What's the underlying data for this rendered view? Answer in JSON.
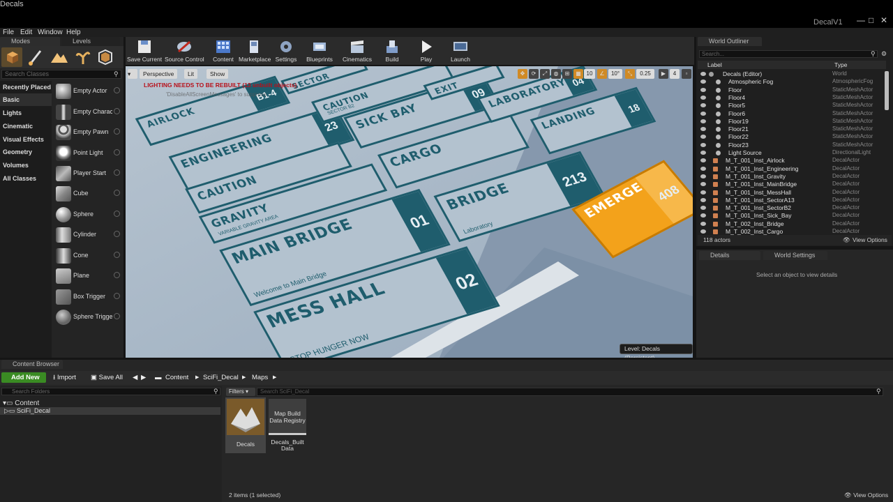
{
  "window": {
    "tab_title": "Decals",
    "project_name": "DecalV1",
    "logo_letter": "U",
    "controls": [
      "—",
      "□",
      "✕"
    ]
  },
  "menu": [
    "File",
    "Edit",
    "Window",
    "Help"
  ],
  "modes_panel": {
    "tab_modes": "Modes",
    "tab_levels": "Levels",
    "search_placeholder": "Search Classes",
    "categories": [
      "Recently Placed",
      "Basic",
      "Lights",
      "Cinematic",
      "Visual Effects",
      "Geometry",
      "Volumes",
      "All Classes"
    ],
    "selected_category": "Basic",
    "items": [
      "Empty Actor",
      "Empty Charact",
      "Empty Pawn",
      "Point Light",
      "Player Start",
      "Cube",
      "Sphere",
      "Cylinder",
      "Cone",
      "Plane",
      "Box Trigger",
      "Sphere Trigge"
    ]
  },
  "toolbar": {
    "buttons": [
      "Save Current",
      "Source Control",
      "Content",
      "Marketplace",
      "Settings",
      "Blueprints",
      "Cinematics",
      "Build",
      "Play",
      "Launch"
    ]
  },
  "viewport": {
    "perspective": "Perspective",
    "lit": "Lit",
    "show": "Show",
    "warning": "LIGHTING NEEDS TO BE REBUILT (13 unbuilt objects)",
    "warning_sub": "'DisableAllScreenMessages' to suppress",
    "level": "Level:  Decals (Persistent)",
    "grid_snap": "10",
    "rot_snap": "10°",
    "scale_snap": "0.25",
    "cam_speed": "4",
    "signs": [
      {
        "title": "AIRLOCK",
        "num": "B1-4"
      },
      {
        "title": "ENGINEERING",
        "num": "23"
      },
      {
        "title": "CAUTION",
        "num": ""
      },
      {
        "title": "GRAVITY",
        "num": "",
        "sub": "VARIABLE GRAVITY AREA"
      },
      {
        "title": "MAIN BRIDGE",
        "num": "01",
        "sub": "Welcome to Main Bridge"
      },
      {
        "title": "MESS HALL",
        "num": "02",
        "sub": "STOP HUNGER NOW"
      },
      {
        "title": "SICK BAY",
        "num": "09"
      },
      {
        "title": "CARGO",
        "num": ""
      },
      {
        "title": "BRIDGE",
        "num": "213",
        "sub": "Laboratory"
      },
      {
        "title": "LABORATORY",
        "num": "04"
      },
      {
        "title": "LANDING",
        "num": "18"
      },
      {
        "title": "CAUTION",
        "num": "",
        "sub": "SECTOR B2"
      },
      {
        "title": "SECTOR",
        "num": ""
      },
      {
        "title": "EXIT",
        "num": ""
      },
      {
        "title": "EMERGENCY",
        "num": "408"
      }
    ]
  },
  "outliner": {
    "tab": "World Outliner",
    "search_placeholder": "Search...",
    "col_label": "Label",
    "col_type": "Type",
    "rows": [
      {
        "label": "Decals (Editor)",
        "type": "World",
        "indent": 0
      },
      {
        "label": "Atmospheric Fog",
        "type": "AtmosphericFog",
        "indent": 1
      },
      {
        "label": "Floor",
        "type": "StaticMeshActor",
        "indent": 1
      },
      {
        "label": "Floor4",
        "type": "StaticMeshActor",
        "indent": 1
      },
      {
        "label": "Floor5",
        "type": "StaticMeshActor",
        "indent": 1
      },
      {
        "label": "Floor6",
        "type": "StaticMeshActor",
        "indent": 1
      },
      {
        "label": "Floor19",
        "type": "StaticMeshActor",
        "indent": 1
      },
      {
        "label": "Floor21",
        "type": "StaticMeshActor",
        "indent": 1
      },
      {
        "label": "Floor22",
        "type": "StaticMeshActor",
        "indent": 1
      },
      {
        "label": "Floor23",
        "type": "StaticMeshActor",
        "indent": 1
      },
      {
        "label": "Light Source",
        "type": "DirectionalLight",
        "indent": 1
      },
      {
        "label": "M_T_001_Inst_Airlock",
        "type": "DecalActor",
        "indent": 0
      },
      {
        "label": "M_T_001_Inst_Engineering",
        "type": "DecalActor",
        "indent": 0
      },
      {
        "label": "M_T_001_Inst_Gravity",
        "type": "DecalActor",
        "indent": 0
      },
      {
        "label": "M_T_001_Inst_MainBridge",
        "type": "DecalActor",
        "indent": 0
      },
      {
        "label": "M_T_001_Inst_MessHall",
        "type": "DecalActor",
        "indent": 0
      },
      {
        "label": "M_T_001_Inst_SectorA13",
        "type": "DecalActor",
        "indent": 0
      },
      {
        "label": "M_T_001_Inst_SectorB2",
        "type": "DecalActor",
        "indent": 0
      },
      {
        "label": "M_T_001_Inst_Sick_Bay",
        "type": "DecalActor",
        "indent": 0
      },
      {
        "label": "M_T_002_Inst_Bridge",
        "type": "DecalActor",
        "indent": 0
      },
      {
        "label": "M_T_002_Inst_Cargo",
        "type": "DecalActor",
        "indent": 0
      }
    ],
    "count": "118 actors",
    "view_options": "View Options"
  },
  "details": {
    "tab": "Details",
    "tab2": "World Settings",
    "message": "Select an object to view details"
  },
  "content_browser": {
    "tab": "Content Browser",
    "add_new": "Add New",
    "import": "Import",
    "save_all": "Save All",
    "breadcrumbs": [
      "Content",
      "SciFi_Decal",
      "Maps"
    ],
    "search_folders_placeholder": "Search Folders",
    "folders": [
      "Content",
      "SciFi_Decal"
    ],
    "filters": "Filters",
    "search_assets_placeholder": "Search SciFi_Decal",
    "assets": [
      {
        "name": "Decals",
        "thumb_text": ""
      },
      {
        "name": "Decals_Built Data",
        "thumb_text": "Map Build Data Registry"
      }
    ],
    "status": "2 items (1 selected)",
    "view_options": "View Options"
  },
  "colors": {
    "teal": "#1f5d6d",
    "floor": "#b3c2cf",
    "orange": "#f3a21b",
    "warning": "#b8101a",
    "green": "#3a8b23"
  }
}
